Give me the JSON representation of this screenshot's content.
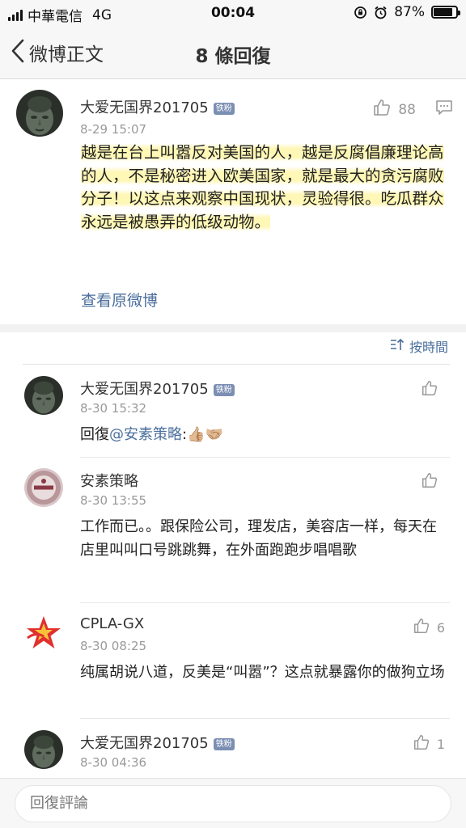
{
  "status_bar": {
    "carrier": "中華電信",
    "network": "4G",
    "time": "00:04",
    "battery": "87%",
    "battery_level": 0.87
  },
  "nav": {
    "back_label": "微博正文",
    "title": "8 條回復"
  },
  "post": {
    "username": "大爱无国界201705",
    "badge": "铁粉",
    "time": "8-29 15:07",
    "likes": "88",
    "text": "越是在台上叫嚣反对美国的人，越是反腐倡廉理论高的人，不是秘密进入欧美国家，就是最大的贪污腐败分子！以这点来观察中国现状，灵验得很。吃瓜群众永远是被愚弄的低级动物。",
    "view_original": "查看原微博"
  },
  "sort_label": "按時間",
  "comments": [
    {
      "username": "大爱无国界201705",
      "badge": "铁粉",
      "time": "8-30 15:32",
      "reply_prefix": "回復",
      "mention": "@安素策略",
      "text_suffix": ":👍🏼🤝🏼",
      "likes": ""
    },
    {
      "username": "安素策略",
      "time": "8-30 13:55",
      "text": "工作而已。。跟保险公司，理发店，美容店一样，每天在店里叫叫口号跳跳舞，在外面跑跑步唱唱歌",
      "likes": ""
    },
    {
      "username": "CPLA-GX",
      "time": "8-30 08:25",
      "text": "纯属胡说八道，反美是“叫嚣”？这点就暴露你的做狗立场",
      "likes": "6"
    },
    {
      "username": "大爱无国界201705",
      "badge": "铁粉",
      "time": "8-30 04:36",
      "likes": "1"
    }
  ],
  "reply_bar": {
    "placeholder": "回復評論"
  },
  "icons": {
    "back": "chevron-left-icon",
    "like": "thumbs-up-icon",
    "comment": "comment-bubble-icon",
    "sort": "sort-icon",
    "lock": "orientation-lock-icon",
    "alarm": "alarm-icon"
  },
  "colors": {
    "link": "#4a6e9c",
    "badge": "#7b8fb3",
    "highlight": "#fff078"
  }
}
